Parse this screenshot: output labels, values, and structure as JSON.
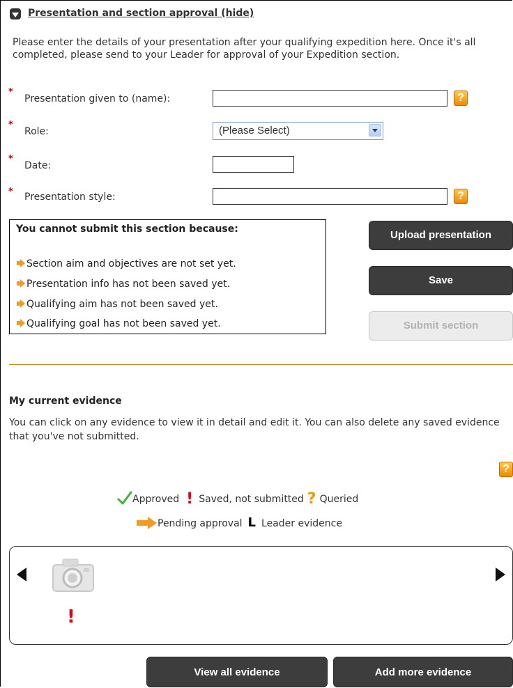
{
  "section": {
    "title": "Presentation and section approval (hide)",
    "intro": "Please enter the details of your presentation after your qualifying expedition here. Once it's all completed, please send to your Leader for approval of your Expedition section."
  },
  "form": {
    "required_marker": "*",
    "help_glyph": "?",
    "fields": [
      {
        "label": "Presentation given to (name):",
        "value": ""
      },
      {
        "label": "Role:",
        "value": "(Please Select)"
      },
      {
        "label": "Date:",
        "value": ""
      },
      {
        "label": "Presentation style:",
        "value": ""
      }
    ]
  },
  "cannot_submit": {
    "title": "You cannot submit this section because:",
    "reasons": [
      "Section aim and objectives are not set yet.",
      "Presentation info has not been saved yet.",
      "Qualifying aim has not been saved yet.",
      "Qualifying goal has not been saved yet."
    ]
  },
  "buttons": {
    "upload": "Upload presentation",
    "save": "Save",
    "submit": "Submit section",
    "view_all": "View all evidence",
    "add_more": "Add more evidence"
  },
  "evidence": {
    "title": "My current evidence",
    "description": "You can click on any evidence to view it in detail and edit it. You can also delete any saved evidence that you've not submitted.",
    "legend": {
      "approved": "Approved",
      "saved": "Saved, not submitted",
      "queried": "Queried",
      "pending": "Pending approval",
      "leader": "Leader evidence",
      "saved_glyph": "!",
      "queried_glyph": "?",
      "leader_glyph": "L"
    },
    "item_status_glyph": "!"
  },
  "colors": {
    "accent_orange": "#f39a1f",
    "required_red": "#cc0000",
    "button_dark": "#3d3d3d",
    "divider": "#c98a2e"
  }
}
